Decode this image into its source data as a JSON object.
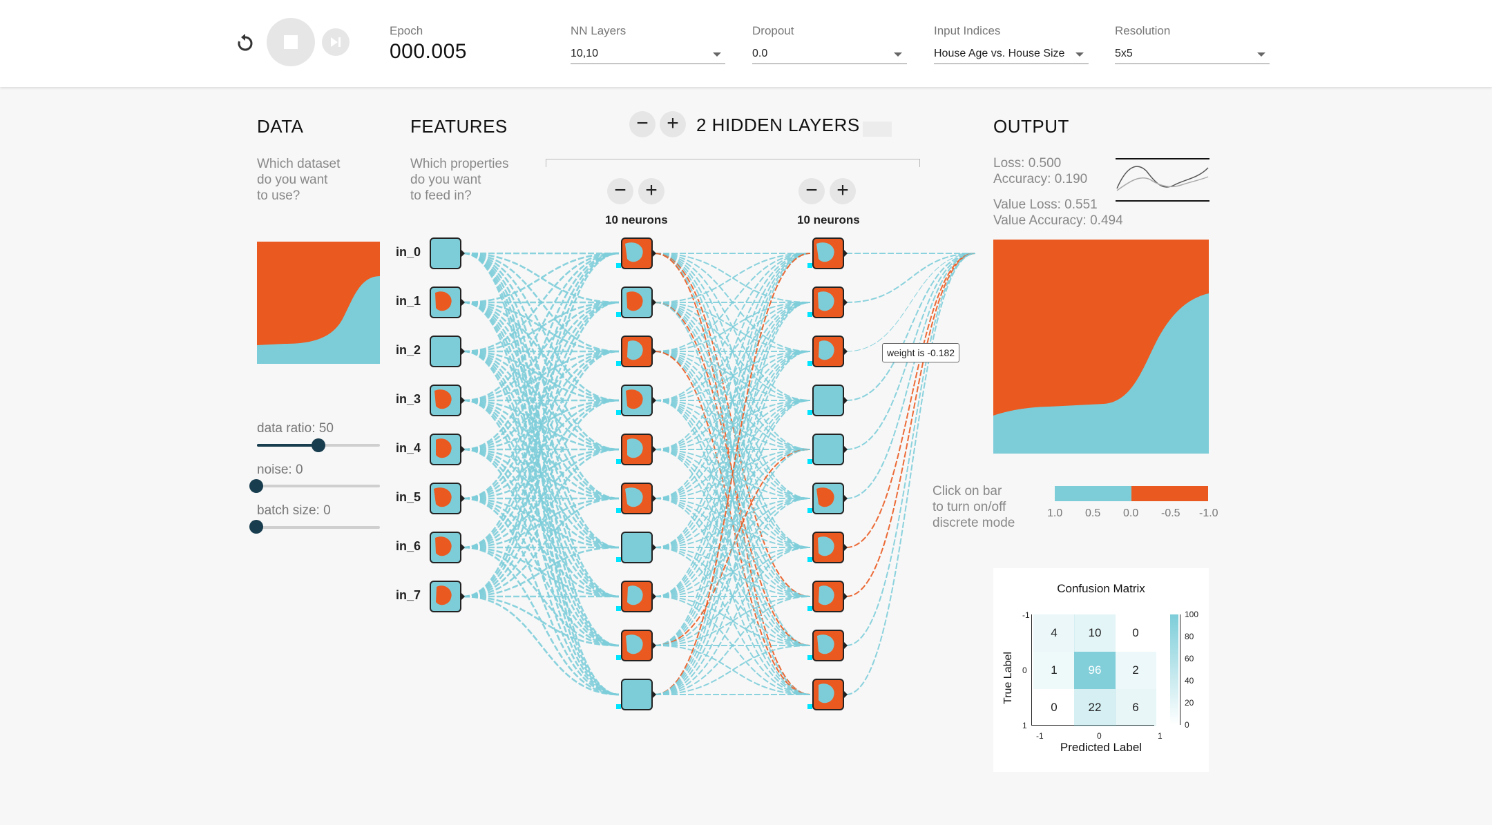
{
  "controls": {
    "epoch_label": "Epoch",
    "epoch_value": "000.005",
    "nn_layers_label": "NN Layers",
    "nn_layers_value": "10,10",
    "dropout_label": "Dropout",
    "dropout_value": "0.0",
    "input_indices_label": "Input Indices",
    "input_indices_value": "House Age vs. House Size",
    "resolution_label": "Resolution",
    "resolution_value": "5x5"
  },
  "data_section": {
    "title": "DATA",
    "subtitle": [
      "Which dataset",
      "do you want",
      "to use?"
    ],
    "data_ratio_label": "data ratio: 50",
    "data_ratio_value": 50,
    "noise_label": "noise: 0",
    "noise_value": 0,
    "batch_label": "batch size: 0",
    "batch_value": 0
  },
  "features_section": {
    "title": "FEATURES",
    "subtitle": [
      "Which properties",
      "do you want",
      "to feed in?"
    ],
    "inputs": [
      "in_0",
      "in_1",
      "in_2",
      "in_3",
      "in_4",
      "in_5",
      "in_6",
      "in_7"
    ]
  },
  "network": {
    "hidden_title": "2 HIDDEN LAYERS",
    "layer1_label": "10 neurons",
    "layer2_label": "10 neurons",
    "tooltip": "weight is -0.182"
  },
  "output": {
    "title": "OUTPUT",
    "loss": "Loss: 0.500",
    "accuracy": "Accuracy: 0.190",
    "value_loss": "Value Loss: 0.551",
    "value_accuracy": "Value Accuracy: 0.494",
    "discrete_hint": [
      "Click on bar",
      "to turn on/off",
      "discrete mode"
    ],
    "legend_ticks": [
      "1.0",
      "0.5",
      "0.0",
      "-0.5",
      "-1.0"
    ]
  },
  "confusion_matrix": {
    "title": "Confusion Matrix",
    "xlabel": "Predicted Label",
    "ylabel": "True Label",
    "rows": [
      [
        "4",
        "10",
        "0"
      ],
      [
        "1",
        "96",
        "2"
      ],
      [
        "0",
        "22",
        "6"
      ]
    ],
    "x_ticks": [
      "-1",
      "0",
      "1"
    ],
    "y_ticks": [
      "-1",
      "0",
      "1"
    ],
    "scale_ticks": [
      "100",
      "80",
      "60",
      "40",
      "20",
      "0"
    ]
  },
  "colors": {
    "positive": "#7dcdd9",
    "negative": "#ea5a20",
    "dark": "#183d4e"
  }
}
